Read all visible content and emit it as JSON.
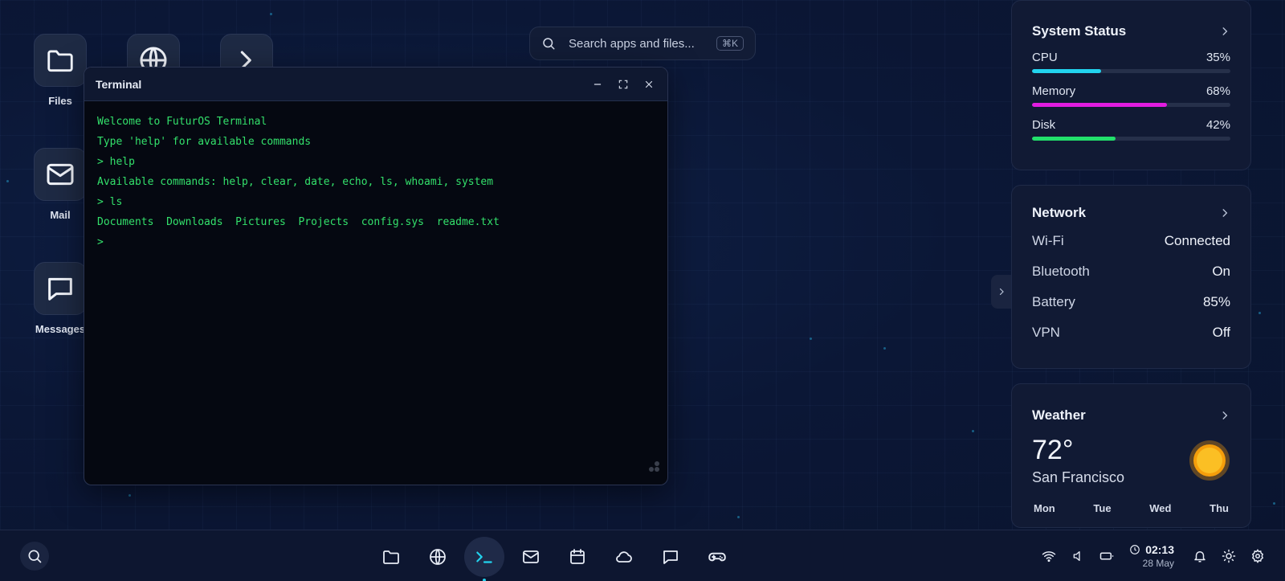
{
  "desktop": {
    "icons": [
      {
        "label": "Files"
      },
      {
        "label": ""
      },
      {
        "label": ""
      },
      {
        "label": "Mail"
      },
      {
        "label": "Messages"
      }
    ]
  },
  "search": {
    "placeholder": "Search apps and files...",
    "shortcut": "⌘K"
  },
  "terminal": {
    "title": "Terminal",
    "lines": [
      "Welcome to FuturOS Terminal",
      "Type 'help' for available commands",
      "> help",
      "Available commands: help, clear, date, echo, ls, whoami, system",
      "> ls",
      "Documents  Downloads  Pictures  Projects  config.sys  readme.txt",
      ">"
    ],
    "text_color": "#33e06b"
  },
  "system_status": {
    "title": "System Status",
    "stats": [
      {
        "label": "CPU",
        "value": "35%",
        "percent": 35,
        "color": "#22d3ee"
      },
      {
        "label": "Memory",
        "value": "68%",
        "percent": 68,
        "color": "#e11ce0"
      },
      {
        "label": "Disk",
        "value": "42%",
        "percent": 42,
        "color": "#22e06b"
      }
    ]
  },
  "network": {
    "title": "Network",
    "rows": [
      {
        "label": "Wi-Fi",
        "value": "Connected"
      },
      {
        "label": "Bluetooth",
        "value": "On"
      },
      {
        "label": "Battery",
        "value": "85%"
      },
      {
        "label": "VPN",
        "value": "Off"
      }
    ]
  },
  "weather": {
    "title": "Weather",
    "temperature": "72°",
    "city": "San Francisco",
    "icon": "sun-icon",
    "days": [
      "Mon",
      "Tue",
      "Wed",
      "Thu"
    ]
  },
  "taskbar": {
    "apps": [
      "folder-icon",
      "globe-icon",
      "terminal-icon",
      "mail-icon",
      "calendar-icon",
      "cloud-icon",
      "message-icon",
      "gamepad-icon"
    ],
    "active_app": "terminal-icon",
    "time": "02:13",
    "date": "28 May",
    "accent": "#22d3ee"
  }
}
